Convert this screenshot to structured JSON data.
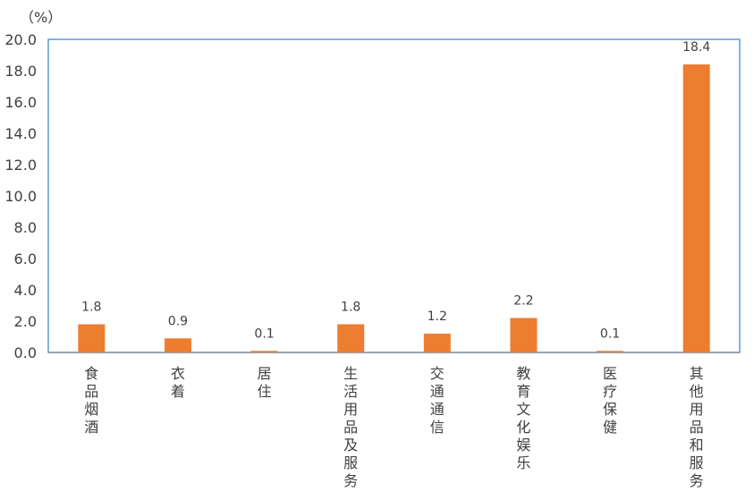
{
  "chart_data": {
    "type": "bar",
    "unit_label": "（%）",
    "categories": [
      "食品烟酒",
      "衣着",
      "居住",
      "生活用品及服务",
      "交通通信",
      "教育文化娱乐",
      "医疗保健",
      "其他用品和服务"
    ],
    "values": [
      1.8,
      0.9,
      0.1,
      1.8,
      1.2,
      2.2,
      0.1,
      18.4
    ],
    "data_labels": [
      "1.8",
      "0.9",
      "0.1",
      "1.8",
      "1.2",
      "2.2",
      "0.1",
      "18.4"
    ],
    "ylim": [
      0,
      20
    ],
    "yticks": [
      "0.0",
      "2.0",
      "4.0",
      "6.0",
      "8.0",
      "10.0",
      "12.0",
      "14.0",
      "16.0",
      "18.0",
      "20.0"
    ],
    "grid": false,
    "legend": "none",
    "colors": {
      "bar": "#ED7D31",
      "frame": "#5B9BD5",
      "text": "#404040",
      "axis": "#7F7F7F"
    }
  }
}
